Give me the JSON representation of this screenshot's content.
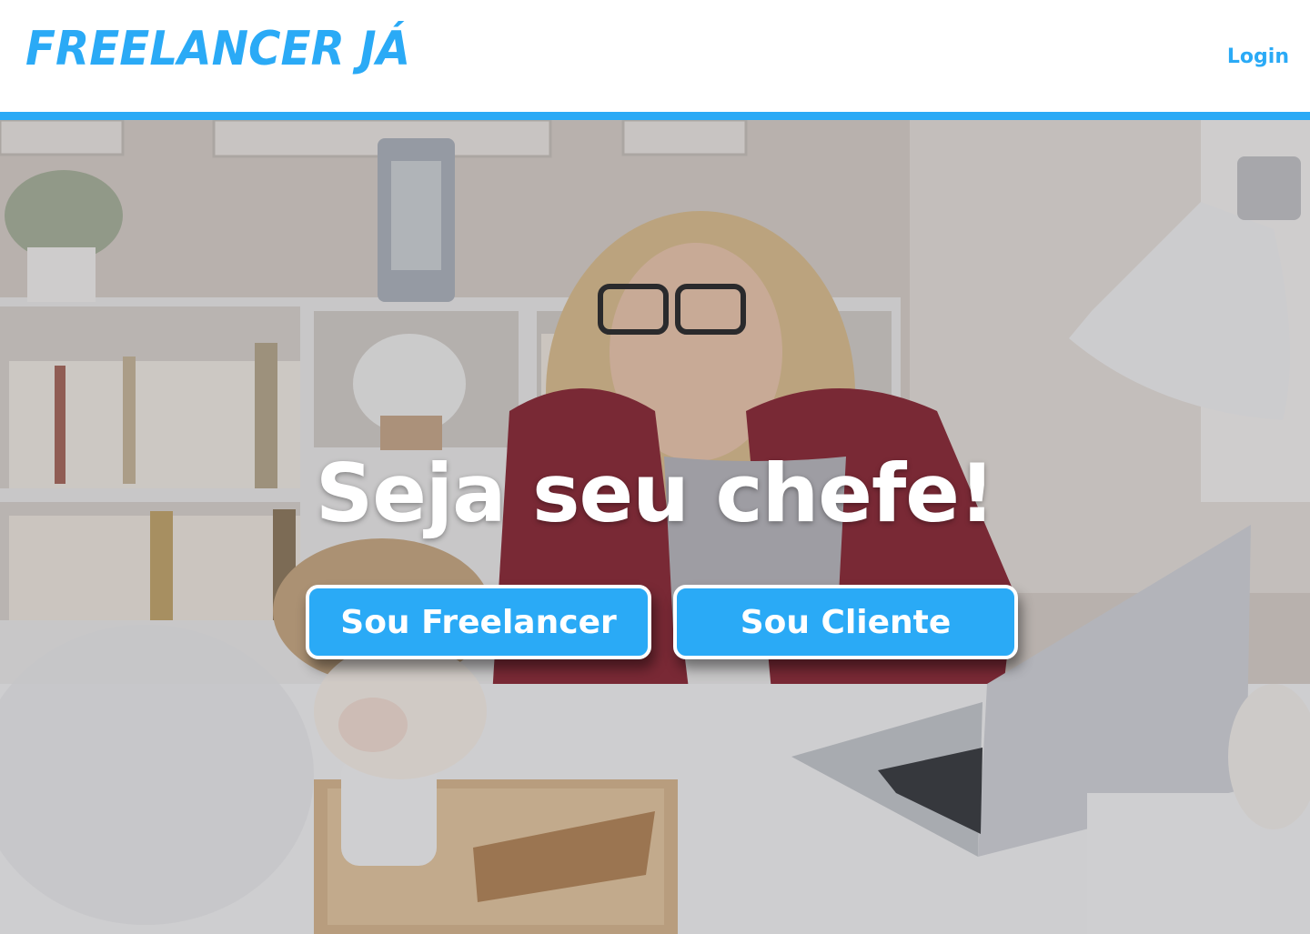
{
  "header": {
    "logo_text": "FREELANCER JÁ",
    "login_label": "Login"
  },
  "hero": {
    "headline": "Seja seu chefe!",
    "buttons": {
      "freelancer_label": "Sou Freelancer",
      "cliente_label": "Sou Cliente"
    }
  },
  "colors": {
    "brand": "#2aaaf6",
    "background": "#ffffff",
    "button_text": "#ffffff"
  }
}
